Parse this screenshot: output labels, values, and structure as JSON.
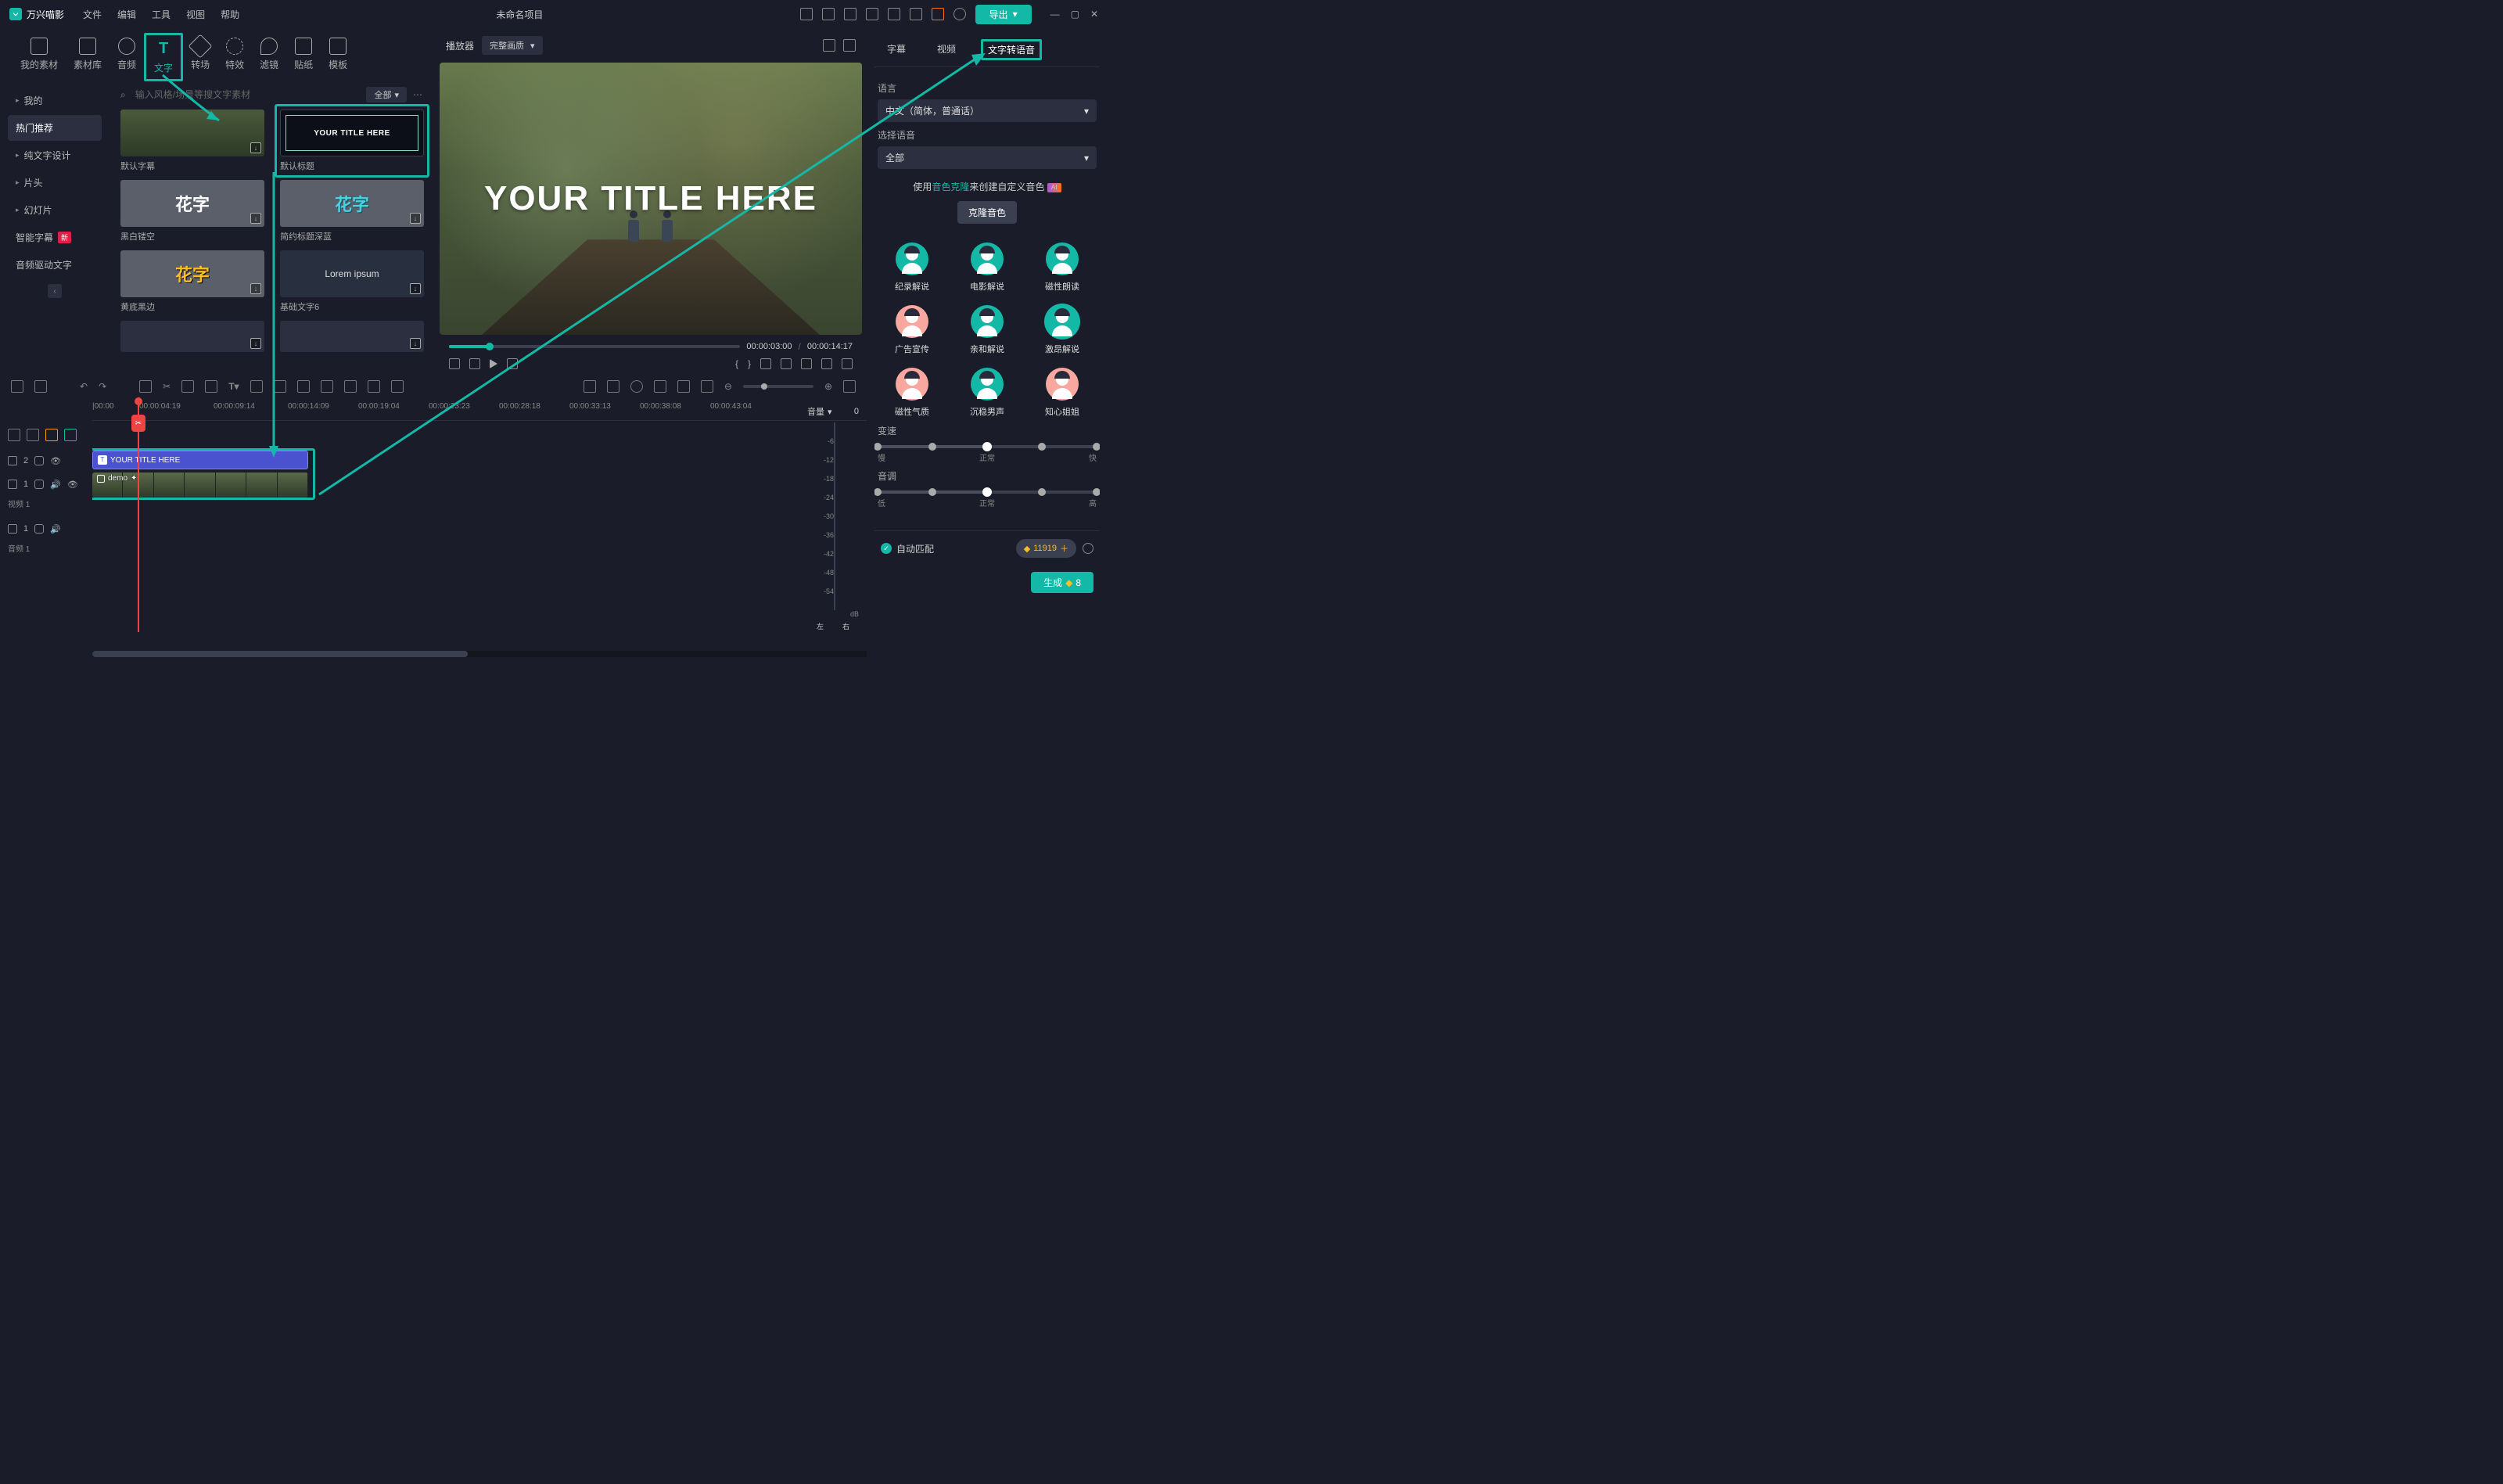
{
  "app": {
    "name": "万兴喵影",
    "project_title": "未命名项目"
  },
  "menus": [
    "文件",
    "编辑",
    "工具",
    "视图",
    "帮助"
  ],
  "export_label": "导出",
  "primary_tabs": [
    {
      "icon": "my-assets",
      "label": "我的素材"
    },
    {
      "icon": "library",
      "label": "素材库"
    },
    {
      "icon": "audio",
      "label": "音频"
    },
    {
      "icon": "text",
      "label": "文字",
      "active": true
    },
    {
      "icon": "transition",
      "label": "转场"
    },
    {
      "icon": "effects",
      "label": "特效"
    },
    {
      "icon": "filters",
      "label": "滤镜"
    },
    {
      "icon": "stickers",
      "label": "贴纸"
    },
    {
      "icon": "templates",
      "label": "模板"
    }
  ],
  "sidebar": {
    "items": [
      {
        "label": "我的",
        "expandable": true
      },
      {
        "label": "热门推荐",
        "active": true
      },
      {
        "label": "纯文字设计",
        "expandable": true
      },
      {
        "label": "片头",
        "expandable": true
      },
      {
        "label": "幻灯片",
        "expandable": true
      },
      {
        "label": "智能字幕",
        "badge": "新"
      },
      {
        "label": "音频驱动文字"
      }
    ]
  },
  "search": {
    "placeholder": "输入风格/场景等搜文字素材",
    "filter": "全部"
  },
  "assets": [
    {
      "name": "默认字幕",
      "kind": "forest"
    },
    {
      "name": "默认标题",
      "kind": "title-here",
      "text": "YOUR TITLE HERE",
      "highlight": true
    },
    {
      "name": "黑白镂空",
      "kind": "hua-white"
    },
    {
      "name": "简约标题深蓝",
      "kind": "hua-blue"
    },
    {
      "name": "黄底黑边",
      "kind": "hua-yellow"
    },
    {
      "name": "基础文字6",
      "kind": "lorem",
      "text": "Lorem ipsum"
    },
    {
      "name": "",
      "kind": "blank"
    },
    {
      "name": "",
      "kind": "blank"
    }
  ],
  "preview": {
    "player_label": "播放器",
    "quality_label": "完整画质",
    "title_text": "YOUR TITLE HERE",
    "current_time": "00:00:03:00",
    "total_time": "00:00:14:17"
  },
  "right": {
    "tabs": [
      "字幕",
      "视频",
      "文字转语音"
    ],
    "active_tab": 2,
    "lang_label": "语言",
    "lang_value": "中文（简体，普通话）",
    "voice_select_label": "选择语音",
    "voice_filter": "全部",
    "clone_text_pre": "使用",
    "clone_link": "音色克隆",
    "clone_text_post": "来创建自定义音色",
    "clone_btn": "克隆音色",
    "voices": [
      {
        "name": "纪录解说",
        "gender": "m"
      },
      {
        "name": "电影解说",
        "gender": "m"
      },
      {
        "name": "磁性朗读",
        "gender": "m"
      },
      {
        "name": "广告宣传",
        "gender": "f"
      },
      {
        "name": "亲和解说",
        "gender": "m"
      },
      {
        "name": "激昂解说",
        "gender": "m",
        "selected": true
      },
      {
        "name": "磁性气质",
        "gender": "f"
      },
      {
        "name": "沉稳男声",
        "gender": "m"
      },
      {
        "name": "知心姐姐",
        "gender": "f"
      }
    ],
    "speed_label": "变速",
    "speed_marks": [
      "慢",
      "正常",
      "快"
    ],
    "pitch_label": "音调",
    "pitch_marks": [
      "低",
      "正常",
      "高"
    ],
    "auto_match": "自动匹配",
    "credits": "11919",
    "generate": "生成",
    "generate_cost": "8"
  },
  "timeline": {
    "volume_label": "音量",
    "ruler_marks": [
      "|00:00",
      "00:00:04:19",
      "00:00:09:14",
      "00:00:14:09",
      "00:00:19:04",
      "00:00:23:23",
      "00:00:28:18",
      "00:00:33:13",
      "00:00:38:08",
      "00:00:43:04"
    ],
    "text_track": {
      "label": "YOUR TITLE HERE"
    },
    "video_track": {
      "label": "demo",
      "sublabel": "视频 1"
    },
    "audio_track": {
      "sublabel": "音频 1"
    },
    "meter": {
      "top": "0",
      "ticks": [
        "-6",
        "-12",
        "-18",
        "-24",
        "-30",
        "-36",
        "-42",
        "-48",
        "-54"
      ],
      "unit": "dB",
      "left": "左",
      "right": "右"
    }
  }
}
